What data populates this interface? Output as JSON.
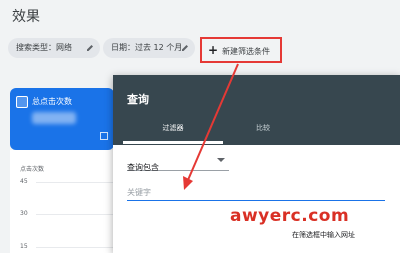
{
  "page": {
    "title": "效果"
  },
  "filters": {
    "search_type": "搜索类型：网络",
    "date": "日期：过去 12 个月",
    "add_filter": "新建筛选条件"
  },
  "metric": {
    "label": "总点击次数"
  },
  "chart": {
    "axis_title": "点击次数",
    "ticks": [
      "45",
      "30",
      "15"
    ]
  },
  "dialog": {
    "title": "查询",
    "tabs": [
      {
        "label": "过滤器"
      },
      {
        "label": "比较"
      }
    ],
    "query_select": {
      "value": "查询包含"
    },
    "keyword_input": {
      "placeholder": "关键字",
      "value": ""
    }
  },
  "watermark": {
    "text": "awyerc.com",
    "subtext": "在筛选框中输入网址"
  },
  "colors": {
    "accent": "#1a73e8",
    "dialog_header": "#37474f",
    "annotation": "#e53935"
  }
}
